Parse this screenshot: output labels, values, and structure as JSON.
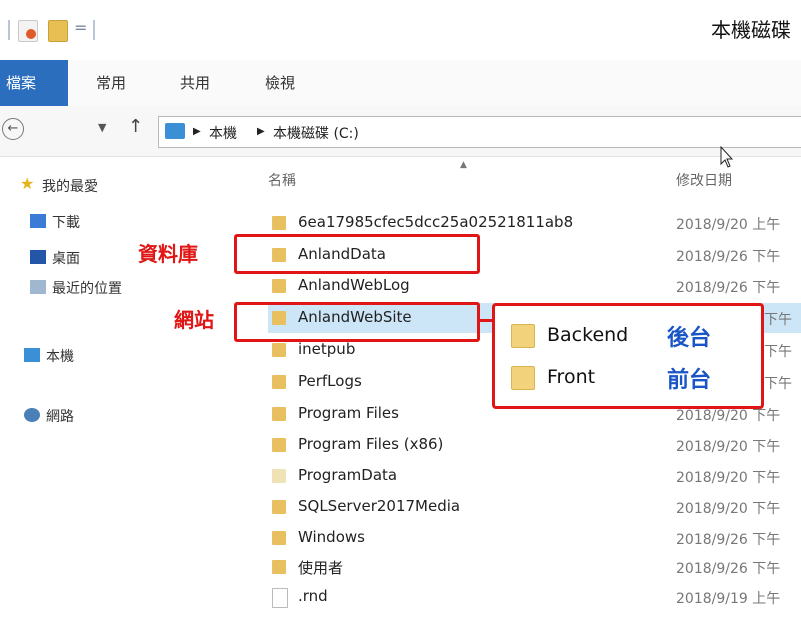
{
  "window": {
    "title": "本機磁碟"
  },
  "ribbon": {
    "tabs": [
      "檔案",
      "常用",
      "共用",
      "檢視"
    ]
  },
  "address": {
    "segments": [
      "本機",
      "本機磁碟 (C:)"
    ]
  },
  "nav": {
    "items": [
      {
        "label": "我的最愛",
        "icon": "star-icon"
      },
      {
        "label": "下載",
        "icon": "download-icon"
      },
      {
        "label": "桌面",
        "icon": "desktop-icon"
      },
      {
        "label": "最近的位置",
        "icon": "recent-icon"
      },
      {
        "label": "本機",
        "icon": "computer-icon"
      },
      {
        "label": "網路",
        "icon": "network-icon"
      }
    ]
  },
  "columns": {
    "name": "名稱",
    "date": "修改日期"
  },
  "files": [
    {
      "name": "6ea17985cfec5dcc25a02521811ab8",
      "date": "2018/9/20 上午",
      "type": "folder"
    },
    {
      "name": "AnlandData",
      "date": "2018/9/26 下午",
      "type": "folder"
    },
    {
      "name": "AnlandWebLog",
      "date": "2018/9/26 下午",
      "type": "folder"
    },
    {
      "name": "AnlandWebSite",
      "date": "下午",
      "type": "folder"
    },
    {
      "name": "inetpub",
      "date": "下午",
      "type": "folder"
    },
    {
      "name": "PerfLogs",
      "date": "下午",
      "type": "folder"
    },
    {
      "name": "Program Files",
      "date": "2018/9/20 下午",
      "type": "folder"
    },
    {
      "name": "Program Files (x86)",
      "date": "2018/9/20 下午",
      "type": "folder"
    },
    {
      "name": "ProgramData",
      "date": "2018/9/20 下午",
      "type": "folder"
    },
    {
      "name": "SQLServer2017Media",
      "date": "2018/9/20 下午",
      "type": "folder"
    },
    {
      "name": "Windows",
      "date": "2018/9/26 下午",
      "type": "folder"
    },
    {
      "name": "使用者",
      "date": "2018/9/26 下午",
      "type": "folder"
    },
    {
      "name": ".rnd",
      "date": "2018/9/19 上午",
      "type": "file"
    }
  ],
  "annotations": {
    "database_label": "資料庫",
    "website_label": "網站",
    "callout": [
      {
        "name": "Backend",
        "label": "後台"
      },
      {
        "name": "Front",
        "label": "前台"
      }
    ]
  },
  "colors": {
    "accent": "#2a6ebd",
    "annotation": "#e01515",
    "callout_text": "#1a55c8",
    "folder": "#e8c060"
  }
}
